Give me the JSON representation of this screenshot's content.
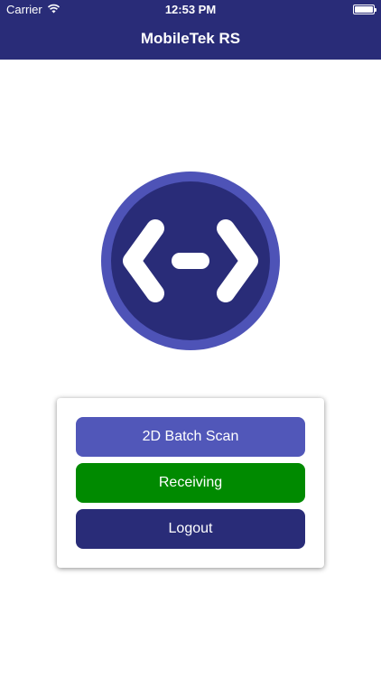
{
  "status": {
    "carrier": "Carrier",
    "time": "12:53 PM",
    "wifi_icon": "wifi-icon",
    "battery_icon": "battery-icon"
  },
  "header": {
    "title": "MobileTek RS",
    "background": "#292c78"
  },
  "logo": {
    "icon": "code-brackets-logo",
    "ring_color": "#4e53b7",
    "fill_color": "#292c78"
  },
  "menu": {
    "buttons": [
      {
        "label": "2D Batch Scan",
        "color": "#5157b9"
      },
      {
        "label": "Receiving",
        "color": "#008a00"
      },
      {
        "label": "Logout",
        "color": "#292c78"
      }
    ]
  }
}
